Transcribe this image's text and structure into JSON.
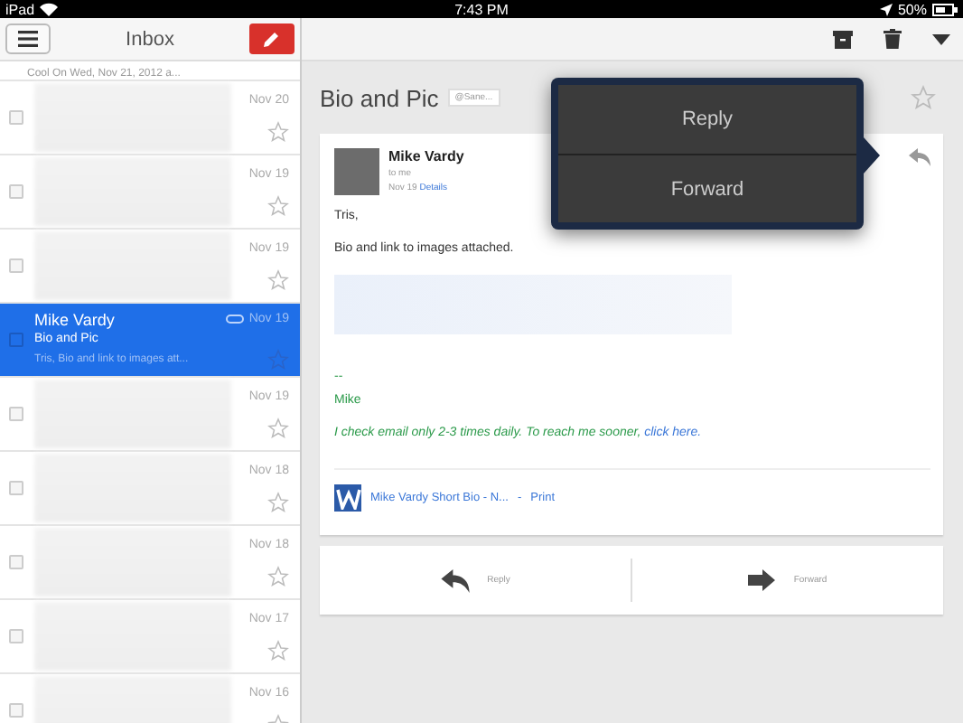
{
  "status_bar": {
    "device": "iPad",
    "time": "7:43 PM",
    "battery": "50%"
  },
  "inbox": {
    "title": "Inbox",
    "rows": [
      {
        "kind": "partial",
        "snippet": "Cool On Wed, Nov 21, 2012 a...",
        "date": "",
        "selected": false
      },
      {
        "kind": "blurred",
        "date": "Nov 20",
        "selected": false
      },
      {
        "kind": "blurred",
        "date": "Nov 19",
        "selected": false
      },
      {
        "kind": "blurred",
        "date": "Nov 19",
        "selected": false
      },
      {
        "kind": "message",
        "sender": "Mike Vardy",
        "subject": "Bio and Pic",
        "snippet": "Tris, Bio and link to images att...",
        "date": "Nov 19",
        "attachment": true,
        "selected": true
      },
      {
        "kind": "blurred",
        "date": "Nov 19",
        "selected": false
      },
      {
        "kind": "blurred",
        "date": "Nov 18",
        "selected": false
      },
      {
        "kind": "blurred",
        "date": "Nov 18",
        "selected": false
      },
      {
        "kind": "blurred",
        "date": "Nov 17",
        "selected": false
      },
      {
        "kind": "blurred",
        "date": "Nov 16",
        "selected": false
      }
    ]
  },
  "message": {
    "subject": "Bio and Pic",
    "label": "@Sane...",
    "sender": "Mike Vardy",
    "to": "to me",
    "date": "Nov 19",
    "details_link": "Details",
    "body": [
      "Tris,",
      "Bio and link to images attached."
    ],
    "signature": {
      "dashes": "--",
      "name": "Mike",
      "note": "I check email only 2-3 times daily. To reach me sooner,",
      "link": "click here."
    },
    "attachment": {
      "name": "Mike Vardy Short Bio - N...",
      "separator": "-",
      "action": "Print"
    }
  },
  "reply_bar": [
    "Reply",
    "Forward"
  ],
  "popover_menu": [
    "Reply",
    "Forward"
  ]
}
